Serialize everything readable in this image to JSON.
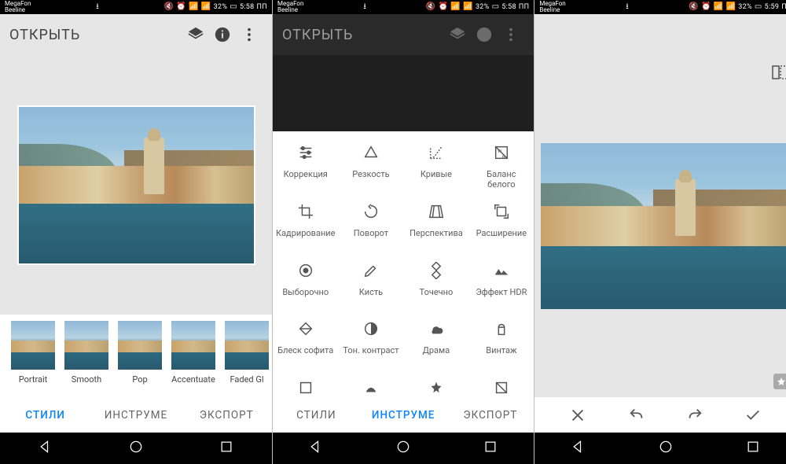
{
  "statusbar": {
    "carrier1": "MegaFon",
    "carrier2": "Beeline",
    "battery": "32%",
    "time_a": "5:58",
    "time_b": "5:59",
    "period": "ПП"
  },
  "header": {
    "open_label": "ОТКРЫТЬ"
  },
  "tabs": {
    "styles": "СТИЛИ",
    "tools": "ИНСТРУМЕ",
    "export": "ЭКСПОРТ"
  },
  "styles": [
    "Portrait",
    "Smooth",
    "Pop",
    "Accentuate",
    "Faded Gl"
  ],
  "tools": [
    {
      "icon": "tune",
      "label": "Коррекция"
    },
    {
      "icon": "details",
      "label": "Резкость"
    },
    {
      "icon": "curves",
      "label": "Кривые"
    },
    {
      "icon": "wb",
      "label": "Баланс белого"
    },
    {
      "icon": "crop",
      "label": "Кадрирование"
    },
    {
      "icon": "rotate",
      "label": "Поворот"
    },
    {
      "icon": "perspective",
      "label": "Перспектива"
    },
    {
      "icon": "expand",
      "label": "Расширение"
    },
    {
      "icon": "selective",
      "label": "Выборочно"
    },
    {
      "icon": "brush",
      "label": "Кисть"
    },
    {
      "icon": "heal",
      "label": "Точечно"
    },
    {
      "icon": "hdr",
      "label": "Эффект HDR"
    },
    {
      "icon": "glamour",
      "label": "Блеск софита"
    },
    {
      "icon": "tonal",
      "label": "Тон. контраст"
    },
    {
      "icon": "drama",
      "label": "Драма"
    },
    {
      "icon": "vintage",
      "label": "Винтаж"
    },
    {
      "icon": "more1",
      "label": ""
    },
    {
      "icon": "more2",
      "label": ""
    },
    {
      "icon": "more3",
      "label": ""
    },
    {
      "icon": "more4",
      "label": ""
    }
  ]
}
